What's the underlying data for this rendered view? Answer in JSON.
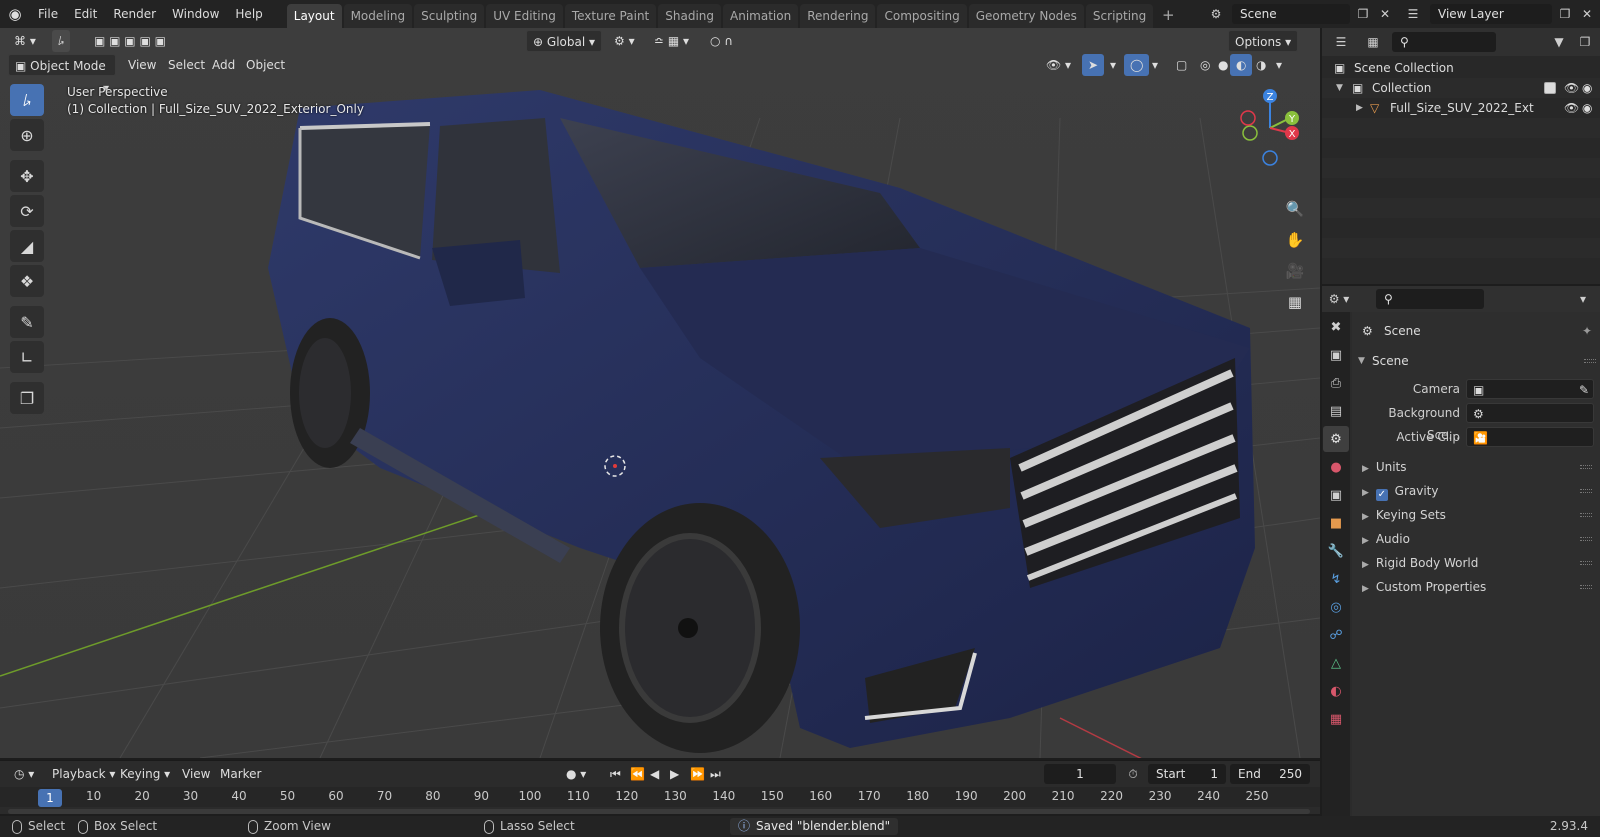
{
  "menus": [
    "File",
    "Edit",
    "Render",
    "Window",
    "Help"
  ],
  "workspaces": [
    "Layout",
    "Modeling",
    "Sculpting",
    "UV Editing",
    "Texture Paint",
    "Shading",
    "Animation",
    "Rendering",
    "Compositing",
    "Geometry Nodes",
    "Scripting"
  ],
  "active_workspace": "Layout",
  "scene_name": "Scene",
  "view_layer": "View Layer",
  "viewport": {
    "mode": "Object Mode",
    "menus": [
      "View",
      "Select",
      "Add",
      "Object"
    ],
    "transform_orientation": "Global",
    "options_label": "Options",
    "perspective": "User Perspective",
    "collection_info": "(1) Collection | Full_Size_SUV_2022_Exterior_Only",
    "gizmo_axes": {
      "x": "X",
      "y": "Y",
      "z": "Z"
    }
  },
  "timeline": {
    "menus": [
      "Playback",
      "Keying",
      "View",
      "Marker"
    ],
    "current_frame": "1",
    "start_label": "Start",
    "start": "1",
    "end_label": "End",
    "end": "250",
    "ticks": [
      "1",
      "10",
      "20",
      "30",
      "40",
      "50",
      "60",
      "70",
      "80",
      "90",
      "100",
      "110",
      "120",
      "130",
      "140",
      "150",
      "160",
      "170",
      "180",
      "190",
      "200",
      "210",
      "220",
      "230",
      "240",
      "250"
    ]
  },
  "statusbar": {
    "select": "Select",
    "box_select": "Box Select",
    "zoom_view": "Zoom View",
    "lasso_select": "Lasso Select",
    "message": "Saved \"blender.blend\"",
    "version": "2.93.4"
  },
  "outliner": {
    "scene_collection": "Scene Collection",
    "collection": "Collection",
    "object": "Full_Size_SUV_2022_Ext"
  },
  "properties": {
    "context": "Scene",
    "panel_title": "Scene",
    "camera_label": "Camera",
    "background_scene_label": "Background Sce...",
    "active_clip_label": "Active Clip",
    "subpanels": [
      "Units",
      "Gravity",
      "Keying Sets",
      "Audio",
      "Rigid Body World",
      "Custom Properties"
    ],
    "gravity_checked": true
  },
  "colors": {
    "accent": "#4772b3",
    "axis_x": "#e0384a",
    "axis_y": "#8ac03c",
    "axis_z": "#3b83e0",
    "car_body": "#27305a"
  }
}
